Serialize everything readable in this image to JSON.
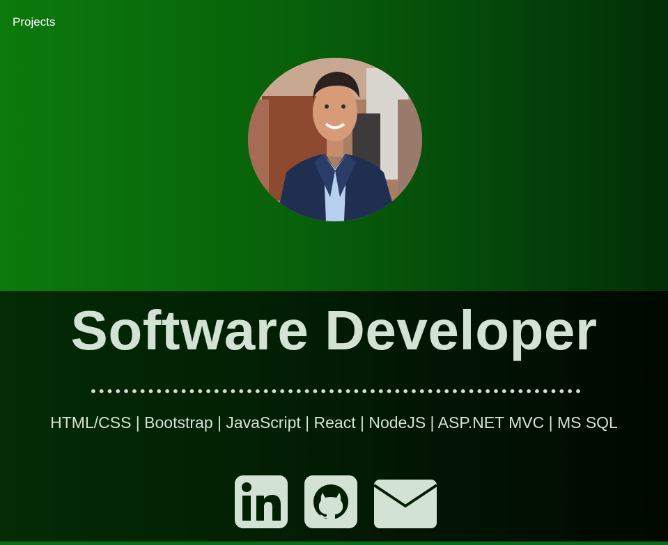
{
  "nav": {
    "projects_label": "Projects"
  },
  "profile": {
    "avatar_alt": "Profile photo"
  },
  "hero": {
    "title": "Software Developer",
    "skills": "HTML/CSS | Bootstrap | JavaScript | React | NodeJS | ASP.NET MVC | MS SQL"
  },
  "social": {
    "linkedin_icon": "linkedin-icon",
    "github_icon": "github-icon",
    "email_icon": "envelope-icon"
  },
  "colors": {
    "hero_green": "#0c7a0c",
    "dark_bg": "#021f04",
    "text": "#d3e3d3",
    "bottom_bar": "#0c6e14"
  }
}
